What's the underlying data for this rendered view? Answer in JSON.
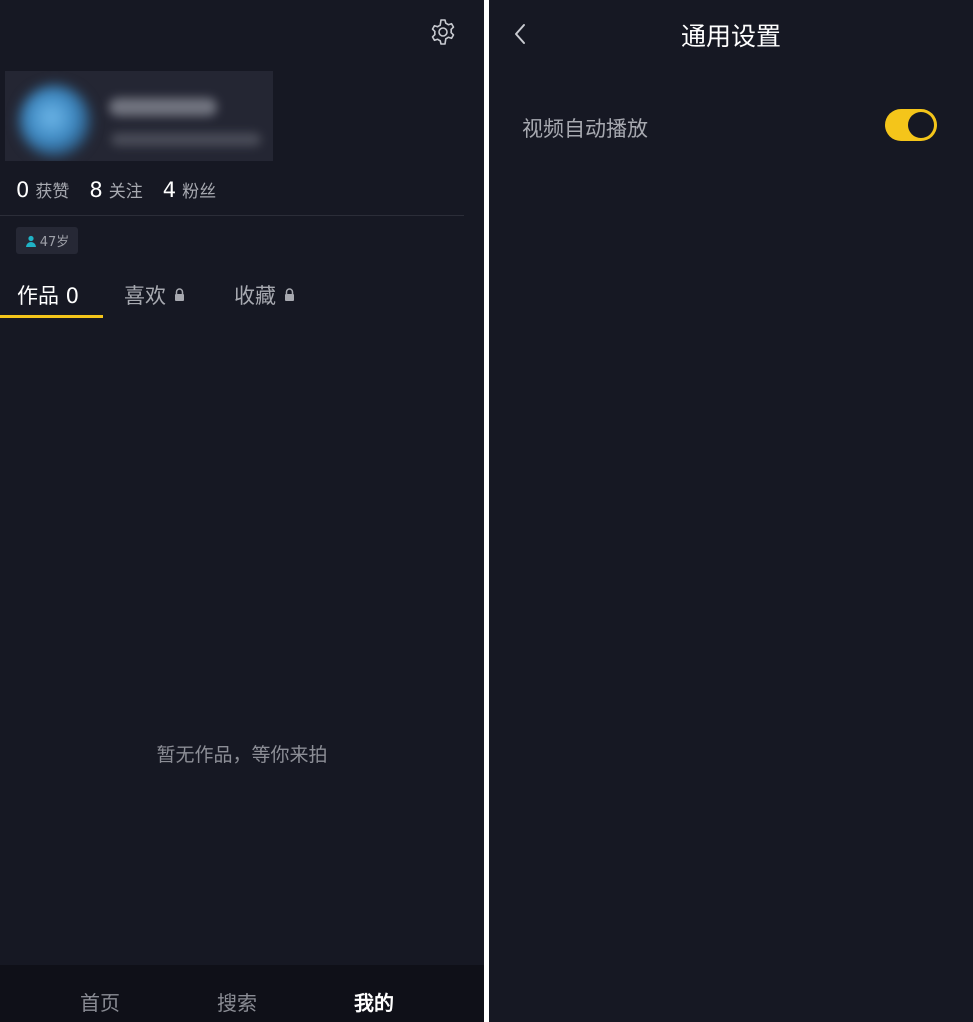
{
  "profile": {
    "stats": [
      {
        "num": "0",
        "label": "获赞"
      },
      {
        "num": "8",
        "label": "关注"
      },
      {
        "num": "4",
        "label": "粉丝"
      }
    ],
    "age_tag": "47岁",
    "tabs": [
      {
        "label": "作品 0",
        "locked": false
      },
      {
        "label": "喜欢",
        "locked": true
      },
      {
        "label": "收藏",
        "locked": true
      }
    ],
    "empty_message": "暂无作品，等你来拍",
    "bottom_nav": [
      "首页",
      "搜索",
      "我的"
    ],
    "icons": {
      "settings": "gear-icon",
      "age": "person-icon",
      "lock": "lock-icon"
    }
  },
  "settings_page": {
    "title": "通用设置",
    "rows": [
      {
        "label": "视频自动播放",
        "enabled": true
      }
    ],
    "icons": {
      "back": "chevron-left-icon"
    }
  },
  "colors": {
    "background": "#161823",
    "accent": "#f4c51a",
    "text_primary": "#ffffff",
    "text_secondary": "#a7a9b0",
    "nav_background": "#0f1018"
  }
}
